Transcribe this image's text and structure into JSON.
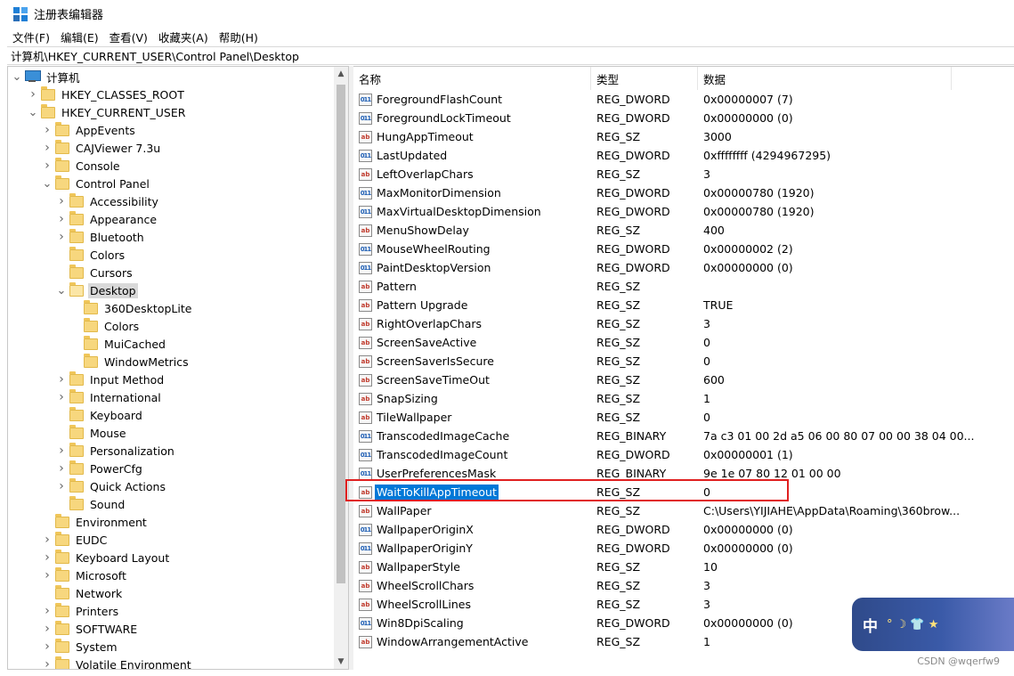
{
  "window": {
    "title": "注册表编辑器"
  },
  "menu": [
    {
      "label": "文件(F)"
    },
    {
      "label": "编辑(E)"
    },
    {
      "label": "查看(V)"
    },
    {
      "label": "收藏夹(A)"
    },
    {
      "label": "帮助(H)"
    }
  ],
  "address": "计算机\\HKEY_CURRENT_USER\\Control Panel\\Desktop",
  "tree": [
    {
      "label": "计算机",
      "level": 0,
      "expander": "open",
      "icon": "computer-icon"
    },
    {
      "label": "HKEY_CLASSES_ROOT",
      "level": 1,
      "expander": "closed"
    },
    {
      "label": "HKEY_CURRENT_USER",
      "level": 1,
      "expander": "open"
    },
    {
      "label": "AppEvents",
      "level": 2,
      "expander": "closed"
    },
    {
      "label": "CAJViewer 7.3u",
      "level": 2,
      "expander": "closed"
    },
    {
      "label": "Console",
      "level": 2,
      "expander": "closed"
    },
    {
      "label": "Control Panel",
      "level": 2,
      "expander": "open"
    },
    {
      "label": "Accessibility",
      "level": 3,
      "expander": "closed"
    },
    {
      "label": "Appearance",
      "level": 3,
      "expander": "closed"
    },
    {
      "label": "Bluetooth",
      "level": 3,
      "expander": "closed"
    },
    {
      "label": "Colors",
      "level": 3,
      "expander": "none"
    },
    {
      "label": "Cursors",
      "level": 3,
      "expander": "none"
    },
    {
      "label": "Desktop",
      "level": 3,
      "expander": "open",
      "selected": true
    },
    {
      "label": "360DesktopLite",
      "level": 4,
      "expander": "none"
    },
    {
      "label": "Colors",
      "level": 4,
      "expander": "none"
    },
    {
      "label": "MuiCached",
      "level": 4,
      "expander": "none"
    },
    {
      "label": "WindowMetrics",
      "level": 4,
      "expander": "none"
    },
    {
      "label": "Input Method",
      "level": 3,
      "expander": "closed"
    },
    {
      "label": "International",
      "level": 3,
      "expander": "closed"
    },
    {
      "label": "Keyboard",
      "level": 3,
      "expander": "none"
    },
    {
      "label": "Mouse",
      "level": 3,
      "expander": "none"
    },
    {
      "label": "Personalization",
      "level": 3,
      "expander": "closed"
    },
    {
      "label": "PowerCfg",
      "level": 3,
      "expander": "closed"
    },
    {
      "label": "Quick Actions",
      "level": 3,
      "expander": "closed"
    },
    {
      "label": "Sound",
      "level": 3,
      "expander": "none"
    },
    {
      "label": "Environment",
      "level": 2,
      "expander": "none"
    },
    {
      "label": "EUDC",
      "level": 2,
      "expander": "closed"
    },
    {
      "label": "Keyboard Layout",
      "level": 2,
      "expander": "closed"
    },
    {
      "label": "Microsoft",
      "level": 2,
      "expander": "closed"
    },
    {
      "label": "Network",
      "level": 2,
      "expander": "none"
    },
    {
      "label": "Printers",
      "level": 2,
      "expander": "closed"
    },
    {
      "label": "SOFTWARE",
      "level": 2,
      "expander": "closed"
    },
    {
      "label": "System",
      "level": 2,
      "expander": "closed"
    },
    {
      "label": "Volatile Environment",
      "level": 2,
      "expander": "closed"
    }
  ],
  "list": {
    "columns": {
      "name": "名称",
      "type": "类型",
      "data": "数据"
    },
    "rows": [
      {
        "name": "ForegroundFlashCount",
        "type": "REG_DWORD",
        "data": "0x00000007 (7)",
        "icon": "bin"
      },
      {
        "name": "ForegroundLockTimeout",
        "type": "REG_DWORD",
        "data": "0x00000000 (0)",
        "icon": "bin"
      },
      {
        "name": "HungAppTimeout",
        "type": "REG_SZ",
        "data": "3000",
        "icon": "sz"
      },
      {
        "name": "LastUpdated",
        "type": "REG_DWORD",
        "data": "0xffffffff (4294967295)",
        "icon": "bin"
      },
      {
        "name": "LeftOverlapChars",
        "type": "REG_SZ",
        "data": "3",
        "icon": "sz"
      },
      {
        "name": "MaxMonitorDimension",
        "type": "REG_DWORD",
        "data": "0x00000780 (1920)",
        "icon": "bin"
      },
      {
        "name": "MaxVirtualDesktopDimension",
        "type": "REG_DWORD",
        "data": "0x00000780 (1920)",
        "icon": "bin"
      },
      {
        "name": "MenuShowDelay",
        "type": "REG_SZ",
        "data": "400",
        "icon": "sz"
      },
      {
        "name": "MouseWheelRouting",
        "type": "REG_DWORD",
        "data": "0x00000002 (2)",
        "icon": "bin"
      },
      {
        "name": "PaintDesktopVersion",
        "type": "REG_DWORD",
        "data": "0x00000000 (0)",
        "icon": "bin"
      },
      {
        "name": "Pattern",
        "type": "REG_SZ",
        "data": "",
        "icon": "sz"
      },
      {
        "name": "Pattern Upgrade",
        "type": "REG_SZ",
        "data": "TRUE",
        "icon": "sz"
      },
      {
        "name": "RightOverlapChars",
        "type": "REG_SZ",
        "data": "3",
        "icon": "sz"
      },
      {
        "name": "ScreenSaveActive",
        "type": "REG_SZ",
        "data": "0",
        "icon": "sz"
      },
      {
        "name": "ScreenSaverIsSecure",
        "type": "REG_SZ",
        "data": "0",
        "icon": "sz"
      },
      {
        "name": "ScreenSaveTimeOut",
        "type": "REG_SZ",
        "data": "600",
        "icon": "sz"
      },
      {
        "name": "SnapSizing",
        "type": "REG_SZ",
        "data": "1",
        "icon": "sz"
      },
      {
        "name": "TileWallpaper",
        "type": "REG_SZ",
        "data": "0",
        "icon": "sz"
      },
      {
        "name": "TranscodedImageCache",
        "type": "REG_BINARY",
        "data": "7a c3 01 00 2d a5 06 00 80 07 00 00 38 04 00...",
        "icon": "bin"
      },
      {
        "name": "TranscodedImageCount",
        "type": "REG_DWORD",
        "data": "0x00000001 (1)",
        "icon": "bin"
      },
      {
        "name": "UserPreferencesMask",
        "type": "REG_BINARY",
        "data": "9e 1e 07 80 12 01 00 00",
        "icon": "bin"
      },
      {
        "name": "WaitToKillAppTimeout",
        "type": "REG_SZ",
        "data": "0",
        "icon": "sz",
        "selected": true
      },
      {
        "name": "WallPaper",
        "type": "REG_SZ",
        "data": "C:\\Users\\YIJIAHE\\AppData\\Roaming\\360brow...",
        "icon": "sz"
      },
      {
        "name": "WallpaperOriginX",
        "type": "REG_DWORD",
        "data": "0x00000000 (0)",
        "icon": "bin"
      },
      {
        "name": "WallpaperOriginY",
        "type": "REG_DWORD",
        "data": "0x00000000 (0)",
        "icon": "bin"
      },
      {
        "name": "WallpaperStyle",
        "type": "REG_SZ",
        "data": "10",
        "icon": "sz"
      },
      {
        "name": "WheelScrollChars",
        "type": "REG_SZ",
        "data": "3",
        "icon": "sz"
      },
      {
        "name": "WheelScrollLines",
        "type": "REG_SZ",
        "data": "3",
        "icon": "sz"
      },
      {
        "name": "Win8DpiScaling",
        "type": "REG_DWORD",
        "data": "0x00000000 (0)",
        "icon": "bin"
      },
      {
        "name": "WindowArrangementActive",
        "type": "REG_SZ",
        "data": "1",
        "icon": "sz"
      }
    ]
  },
  "icon_text": {
    "sz": "ab",
    "bin": "011"
  },
  "ime": {
    "label": "中",
    "symbols": "° ☽ 👕 ★"
  },
  "watermark": "CSDN @wqerfw9",
  "colors": {
    "selection": "#0078d7",
    "highlight_border": "#e02020",
    "folder": "#f7d77e"
  }
}
